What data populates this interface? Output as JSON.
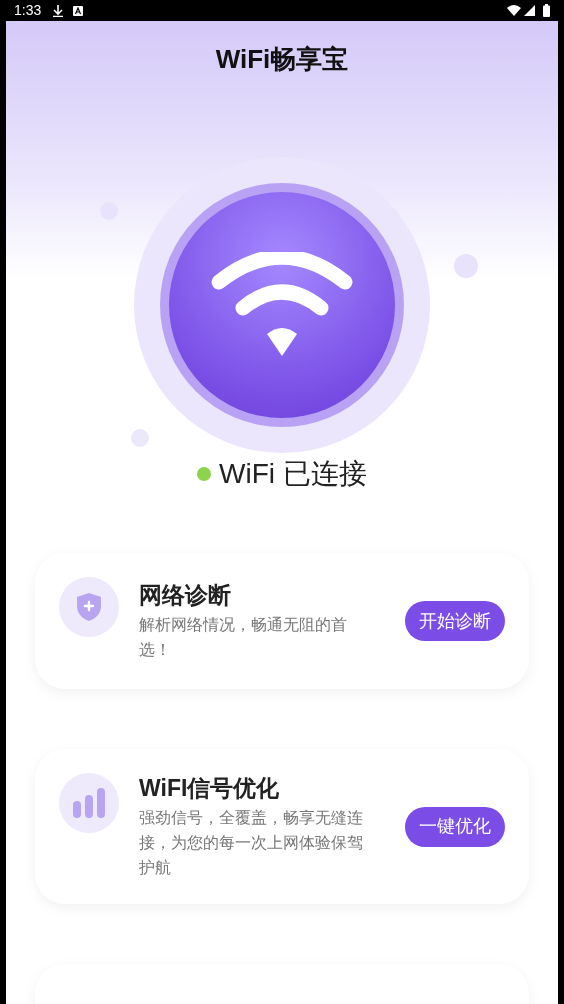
{
  "status_bar": {
    "time": "1:33"
  },
  "header": {
    "title": "WiFi畅享宝"
  },
  "connection": {
    "connected": true,
    "label": "WiFi 已连接"
  },
  "cards": [
    {
      "kind": "shield",
      "title": "网络诊断",
      "description": "解析网络情况，畅通无阻的首选！",
      "button": "开始诊断"
    },
    {
      "kind": "bars",
      "title": "WiFI信号优化",
      "description": "强劲信号，全覆盖，畅享无缝连接，为您的每一次上网体验保驾护航",
      "button": "一键优化"
    }
  ]
}
